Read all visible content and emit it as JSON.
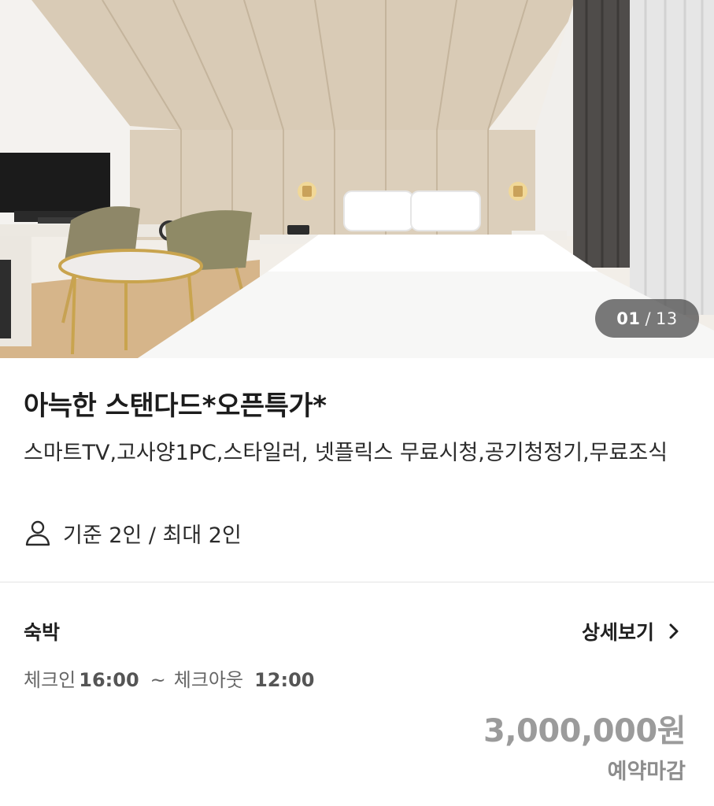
{
  "gallery": {
    "current": "01",
    "separator": "/",
    "total": "13"
  },
  "room": {
    "title": "아늑한 스탠다드*오픈특가*",
    "amenities": "스마트TV,고사양1PC,스타일러, 넷플릭스 무료시청,공기청정기,무료조식",
    "capacity": "기준 2인 / 최대 2인",
    "capacity_icon": "person-outline-icon"
  },
  "stay": {
    "type": "숙박",
    "detail_label": "상세보기",
    "detail_icon": "chevron-right-icon",
    "checkin_label": "체크인",
    "checkin_time": "16:00",
    "tilde": "~",
    "checkout_label": "체크아웃",
    "checkout_time": "12:00",
    "price": "3,000,000원",
    "status": "예약마감"
  },
  "colors": {
    "price": "#9b9b9b",
    "status": "#8d8d8d",
    "counter_bg": "#464646"
  }
}
